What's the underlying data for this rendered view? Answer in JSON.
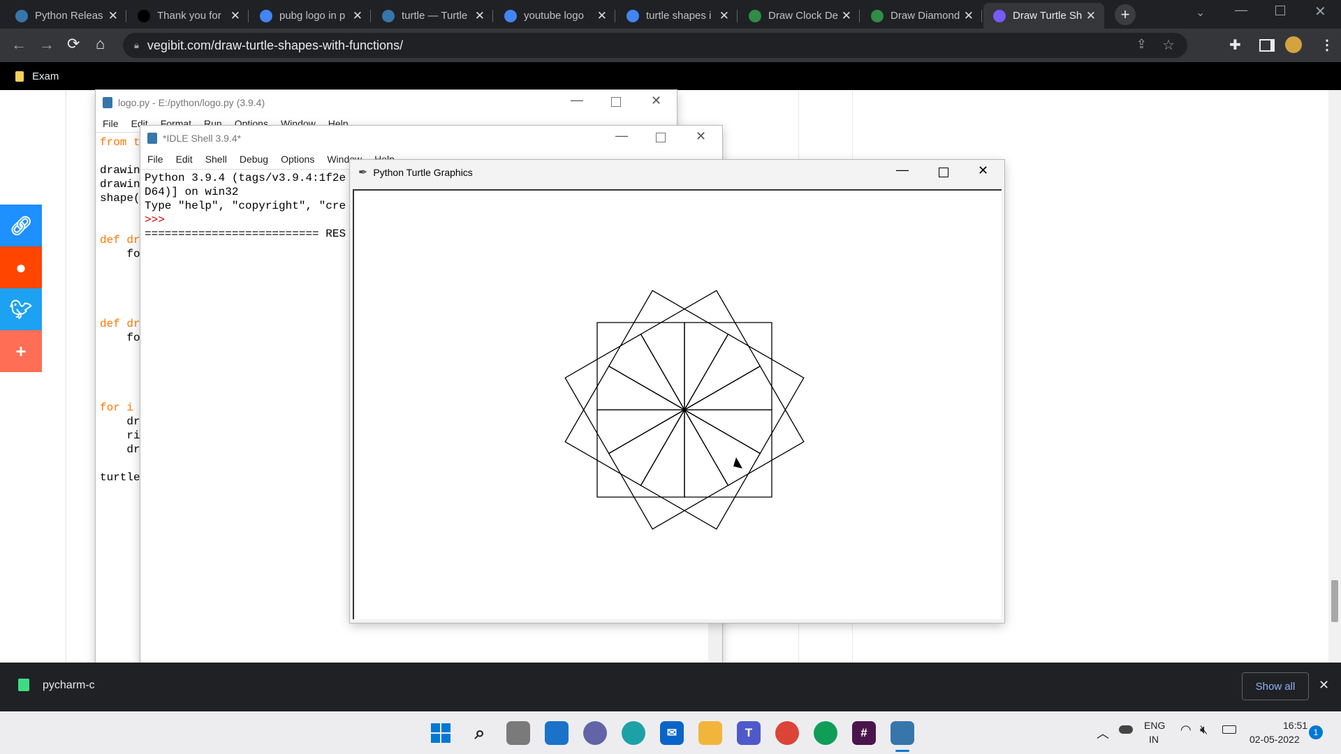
{
  "browser": {
    "tabs": [
      {
        "label": "Python Releas",
        "fav": "py",
        "color": "#3776ab"
      },
      {
        "label": "Thank you for",
        "fav": "JB",
        "color": "#000000"
      },
      {
        "label": "pubg logo in p",
        "fav": "G",
        "color": "#4285f4"
      },
      {
        "label": "turtle — Turtle",
        "fav": "py",
        "color": "#3776ab"
      },
      {
        "label": "youtube logo",
        "fav": "G",
        "color": "#4285f4"
      },
      {
        "label": "turtle shapes i",
        "fav": "G",
        "color": "#4285f4"
      },
      {
        "label": "Draw Clock De",
        "fav": "gfg",
        "color": "#2f8d46"
      },
      {
        "label": "Draw Diamond",
        "fav": "gfg",
        "color": "#2f8d46"
      },
      {
        "label": "Draw Turtle Sh",
        "fav": "vg",
        "color": "#7a5af8",
        "active": true
      }
    ],
    "url": "vegibit.com/draw-turtle-shapes-with-functions/",
    "bookmark": "Exam"
  },
  "share_colors": [
    "#1e90ff",
    "#ff4500",
    "#1da1f2",
    "#ff6e55"
  ],
  "share_icons": [
    "link-icon",
    "reddit-icon",
    "twitter-icon",
    "plus-icon"
  ],
  "logo_window": {
    "title": "logo.py - E:/python/logo.py (3.9.4)",
    "menu": [
      "File",
      "Edit",
      "Format",
      "Run",
      "Options",
      "Window",
      "Help"
    ],
    "code": [
      "from t",
      "",
      "drawin",
      "drawin",
      "shape(",
      "",
      "",
      "def dr",
      "    fo",
      "",
      "",
      "",
      "",
      "def dr",
      "    fo",
      "",
      "",
      "",
      "",
      "for i",
      "    dr",
      "    ri",
      "    dr",
      "",
      "turtle"
    ]
  },
  "shell_window": {
    "title": "*IDLE Shell 3.9.4*",
    "menu": [
      "File",
      "Edit",
      "Shell",
      "Debug",
      "Options",
      "Window",
      "Help"
    ],
    "lines": [
      "Python 3.9.4 (tags/v3.9.4:1f2e",
      "D64)] on win32",
      "Type \"help\", \"copyright\", \"cre"
    ],
    "prompt": ">>>",
    "restart": "========================== RES"
  },
  "turtle_window": {
    "title": "Python Turtle Graphics",
    "square_count": 12,
    "rotation_deg": 30
  },
  "downloads": {
    "item": "pycharm-c",
    "show_all": "Show all"
  },
  "taskbar": {
    "lang": "ENG",
    "region": "IN",
    "time": "16:51",
    "date": "02-05-2022",
    "notifications": "1"
  }
}
